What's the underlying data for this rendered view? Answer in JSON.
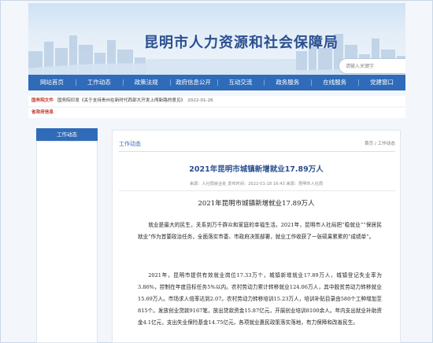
{
  "header": {
    "site_title": "昆明市人力资源和社会保障局",
    "search_placeholder": "请输入关键字"
  },
  "nav": {
    "items": [
      "网站首页",
      "工作动态",
      "政策法规",
      "政府信息公开",
      "互动交流",
      "政务服务",
      "在线服务",
      "党建窗口"
    ]
  },
  "tickers": [
    {
      "tag": "国务院文件",
      "text": "国务院印发《关于支持贵州在新时代西部大开发上闯新路的意见》",
      "date": "2022-01-26"
    },
    {
      "tag": "省政府信息",
      "text": "",
      "date": ""
    }
  ],
  "sidebar": {
    "tab_label": "工作动态"
  },
  "breadcrumb": {
    "title": "工作动态",
    "path": "首页 / 工作动态"
  },
  "article": {
    "title": "2021年昆明市城镇新增就业17.89万人",
    "meta": "来源：人社局就业处  发布时间：2022-01-18 16:43  来源：昆明市人社局",
    "subtitle": "2021年昆明市城镇新增就业17.89万人",
    "paragraph1": "就业是最大的民生，关系到万千群众和家庭的幸福生活。2021年，昆明市人社局把“稳就业”“保居民就业”作为首要政治任务，全面落实市委、市政府决策部署，就业工作收获了一张硕果累累的“成绩单”。",
    "paragraph2": "2021年，昆明市提供有效就业岗位17.33万个，城镇新增就业17.89万人，城镇登记失业率为3.86%，控制在年度目标任务5%以内。农村劳动力累计转移就业124.06万人，其中脱贫劳动力转移就业15.69万人。市场求人倍率达到2.07。农村劳动力转移培训15.23万人，培训补贴目录由580个工种增加至815个。发放创业贷款9167笔，放出贷款资金15.87亿元，开展创业培训8100余人。年内支出就业补助资金4.1亿元，支出失业保险基金14.75亿元，各项就业惠民政策落实落地，有力保障和改善民生。"
  },
  "colors": {
    "nav_blue": "#2f6bb8",
    "title_blue": "#2a4f8f",
    "tag_red": "#c0392b"
  }
}
